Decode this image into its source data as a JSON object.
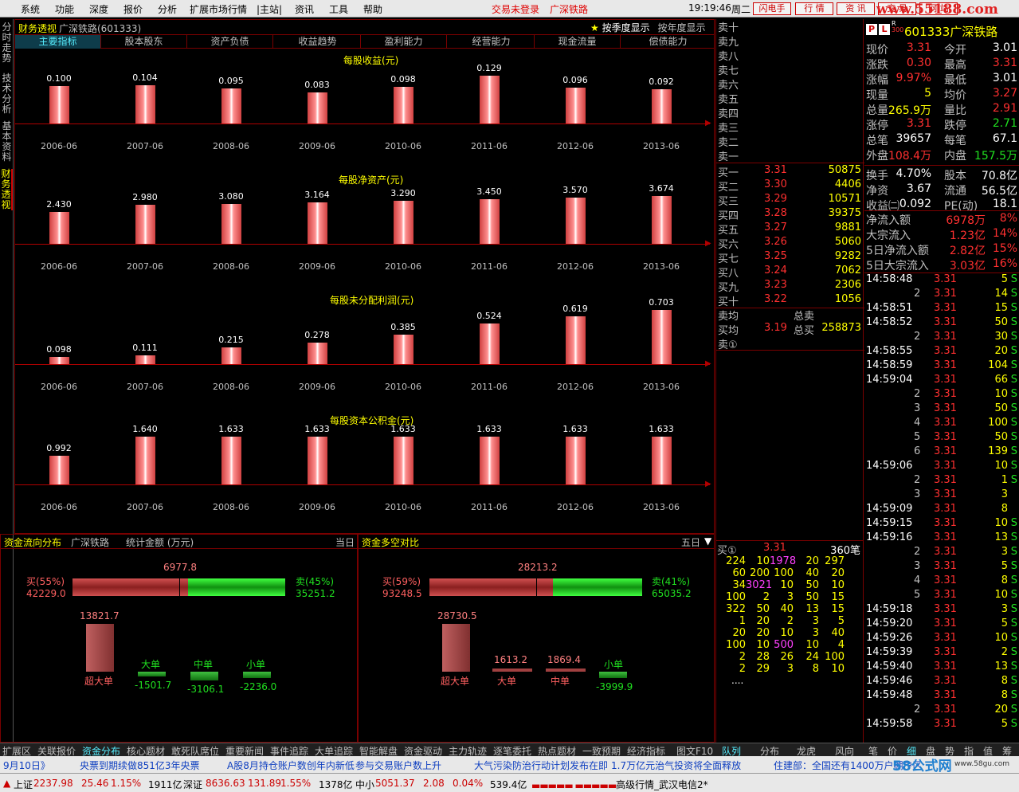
{
  "menu": {
    "items": [
      "系统",
      "功能",
      "深度",
      "报价",
      "分析",
      "扩展市场行情",
      "|主站|",
      "资讯",
      "工具",
      "帮助"
    ],
    "login_status": "交易未登录",
    "current_stock": "广深铁路",
    "time": "19:19:46",
    "weekday": "周二",
    "buttons": [
      "闪电手",
      "行 情",
      "资 讯",
      "交 易",
      "网 站"
    ],
    "watermark": "www.55188.com"
  },
  "side_tabs": [
    "分时走势",
    "技术分析",
    "基本资料",
    "财务透视"
  ],
  "fin": {
    "title": "财务透视",
    "stock": "广深铁路(601333)",
    "season_btn": "按季度显示",
    "year_btn": "按年度显示",
    "tabs": [
      "主要指标",
      "股本股东",
      "资产负债",
      "收益趋势",
      "盈利能力",
      "经营能力",
      "现金流量",
      "偿债能力"
    ],
    "years": [
      "2006-06",
      "2007-06",
      "2008-06",
      "2009-06",
      "2010-06",
      "2011-06",
      "2012-06",
      "2013-06"
    ]
  },
  "chart_data": [
    {
      "type": "bar",
      "title": "每股收益(元)",
      "categories": [
        "2006-06",
        "2007-06",
        "2008-06",
        "2009-06",
        "2010-06",
        "2011-06",
        "2012-06",
        "2013-06"
      ],
      "values": [
        0.1,
        0.104,
        0.095,
        0.083,
        0.098,
        0.129,
        0.096,
        0.092
      ],
      "labels": [
        "0.100",
        "0.104",
        "0.095",
        "0.083",
        "0.098",
        "0.129",
        "0.096",
        "0.092"
      ]
    },
    {
      "type": "bar",
      "title": "每股净资产(元)",
      "categories": [
        "2006-06",
        "2007-06",
        "2008-06",
        "2009-06",
        "2010-06",
        "2011-06",
        "2012-06",
        "2013-06"
      ],
      "values": [
        2.43,
        2.98,
        3.08,
        3.164,
        3.29,
        3.45,
        3.57,
        3.674
      ],
      "labels": [
        "2.430",
        "2.980",
        "3.080",
        "3.164",
        "3.290",
        "3.450",
        "3.570",
        "3.674"
      ]
    },
    {
      "type": "bar",
      "title": "每股未分配利润(元)",
      "categories": [
        "2006-06",
        "2007-06",
        "2008-06",
        "2009-06",
        "2010-06",
        "2011-06",
        "2012-06",
        "2013-06"
      ],
      "values": [
        0.098,
        0.111,
        0.215,
        0.278,
        0.385,
        0.524,
        0.619,
        0.703
      ],
      "labels": [
        "0.098",
        "0.111",
        "0.215",
        "0.278",
        "0.385",
        "0.524",
        "0.619",
        "0.703"
      ]
    },
    {
      "type": "bar",
      "title": "每股资本公积金(元)",
      "categories": [
        "2006-06",
        "2007-06",
        "2008-06",
        "2009-06",
        "2010-06",
        "2011-06",
        "2012-06",
        "2013-06"
      ],
      "values": [
        0.992,
        1.64,
        1.633,
        1.633,
        1.633,
        1.633,
        1.633,
        1.633
      ],
      "labels": [
        "0.992",
        "1.640",
        "1.633",
        "1.633",
        "1.633",
        "1.633",
        "1.633",
        "1.633"
      ]
    }
  ],
  "sell_levels": [
    "卖十",
    "卖九",
    "卖八",
    "卖七",
    "卖六",
    "卖五",
    "卖四",
    "卖三",
    "卖二",
    "卖一"
  ],
  "buy_levels": [
    {
      "l": "买一",
      "p": "3.31",
      "v": "50875"
    },
    {
      "l": "买二",
      "p": "3.30",
      "v": "4406"
    },
    {
      "l": "买三",
      "p": "3.29",
      "v": "10571"
    },
    {
      "l": "买四",
      "p": "3.28",
      "v": "39375"
    },
    {
      "l": "买五",
      "p": "3.27",
      "v": "9881"
    },
    {
      "l": "买六",
      "p": "3.26",
      "v": "5060"
    },
    {
      "l": "买七",
      "p": "3.25",
      "v": "9282"
    },
    {
      "l": "买八",
      "p": "3.24",
      "v": "7062"
    },
    {
      "l": "买九",
      "p": "3.23",
      "v": "2306"
    },
    {
      "l": "买十",
      "p": "3.22",
      "v": "1056"
    }
  ],
  "avg": {
    "sell_label": "卖均",
    "sell_total_label": "总卖",
    "buy_label": "买均",
    "buy_price": "3.19",
    "buy_total_label": "总买",
    "buy_total": "258873",
    "sell1": "卖①"
  },
  "stock": {
    "code": "601333",
    "name": "广深铁路",
    "box_p": "P",
    "box_l": "L",
    "box_r": "R",
    "box_300": "300"
  },
  "info": [
    {
      "l1": "现价",
      "v1": "3.31",
      "c1": "red",
      "l2": "今开",
      "v2": "3.01",
      "c2": "wht"
    },
    {
      "l1": "涨跌",
      "v1": "0.30",
      "c1": "red",
      "l2": "最高",
      "v2": "3.31",
      "c2": "red"
    },
    {
      "l1": "涨幅",
      "v1": "9.97%",
      "c1": "red",
      "l2": "最低",
      "v2": "3.01",
      "c2": "wht"
    },
    {
      "l1": "现量",
      "v1": "5",
      "c1": "yel",
      "l2": "均价",
      "v2": "3.27",
      "c2": "red"
    },
    {
      "l1": "总量",
      "v1": "265.9万",
      "c1": "yel",
      "l2": "量比",
      "v2": "2.91",
      "c2": "red"
    },
    {
      "l1": "涨停",
      "v1": "3.31",
      "c1": "red",
      "l2": "跌停",
      "v2": "2.71",
      "c2": "grn"
    },
    {
      "l1": "总笔",
      "v1": "39657",
      "c1": "wht",
      "l2": "每笔",
      "v2": "67.1",
      "c2": "wht"
    },
    {
      "l1": "外盘",
      "v1": "108.4万",
      "c1": "red",
      "l2": "内盘",
      "v2": "157.5万",
      "c2": "grn"
    },
    {
      "l1": "换手",
      "v1": "4.70%",
      "c1": "wht",
      "l2": "股本",
      "v2": "70.8亿",
      "c2": "wht"
    },
    {
      "l1": "净资",
      "v1": "3.67",
      "c1": "wht",
      "l2": "流通",
      "v2": "56.5亿",
      "c2": "wht"
    },
    {
      "l1": "收益㈡",
      "v1": "0.092",
      "c1": "wht",
      "l2": "PE(动)",
      "v2": "18.1",
      "c2": "wht"
    }
  ],
  "flows": [
    {
      "l": "净流入额",
      "v": "6978万",
      "p": "8%"
    },
    {
      "l": "大宗流入",
      "v": "1.23亿",
      "p": "14%"
    },
    {
      "l": "5日净流入额",
      "v": "2.82亿",
      "p": "15%"
    },
    {
      "l": "5日大宗流入",
      "v": "3.03亿",
      "p": "16%"
    }
  ],
  "ticks": [
    {
      "t": "14:58:48",
      "p": "3.31",
      "v": "5",
      "s": "S"
    },
    {
      "t": "2",
      "p": "3.31",
      "v": "14",
      "s": "S"
    },
    {
      "t": "14:58:51",
      "p": "3.31",
      "v": "15",
      "s": "S"
    },
    {
      "t": "14:58:52",
      "p": "3.31",
      "v": "50",
      "s": "S"
    },
    {
      "t": "2",
      "p": "3.31",
      "v": "30",
      "s": "S"
    },
    {
      "t": "14:58:55",
      "p": "3.31",
      "v": "20",
      "s": "S"
    },
    {
      "t": "14:58:59",
      "p": "3.31",
      "v": "104",
      "s": "S"
    },
    {
      "t": "14:59:04",
      "p": "3.31",
      "v": "66",
      "s": "S"
    },
    {
      "t": "2",
      "p": "3.31",
      "v": "10",
      "s": "S"
    },
    {
      "t": "3",
      "p": "3.31",
      "v": "50",
      "s": "S"
    },
    {
      "t": "4",
      "p": "3.31",
      "v": "100",
      "s": "S"
    },
    {
      "t": "5",
      "p": "3.31",
      "v": "50",
      "s": "S"
    },
    {
      "t": "6",
      "p": "3.31",
      "v": "139",
      "s": "S"
    },
    {
      "t": "14:59:06",
      "p": "3.31",
      "v": "10",
      "s": "S"
    },
    {
      "t": "2",
      "p": "3.31",
      "v": "1",
      "s": "S"
    },
    {
      "t": "3",
      "p": "3.31",
      "v": "3",
      "s": ""
    },
    {
      "t": "14:59:09",
      "p": "3.31",
      "v": "8",
      "s": ""
    },
    {
      "t": "14:59:15",
      "p": "3.31",
      "v": "10",
      "s": "S"
    },
    {
      "t": "14:59:16",
      "p": "3.31",
      "v": "13",
      "s": "S"
    },
    {
      "t": "2",
      "p": "3.31",
      "v": "3",
      "s": "S"
    },
    {
      "t": "3",
      "p": "3.31",
      "v": "5",
      "s": "S"
    },
    {
      "t": "4",
      "p": "3.31",
      "v": "8",
      "s": "S"
    },
    {
      "t": "5",
      "p": "3.31",
      "v": "10",
      "s": "S"
    },
    {
      "t": "14:59:18",
      "p": "3.31",
      "v": "3",
      "s": "S"
    },
    {
      "t": "14:59:20",
      "p": "3.31",
      "v": "5",
      "s": "S"
    },
    {
      "t": "14:59:26",
      "p": "3.31",
      "v": "10",
      "s": "S"
    },
    {
      "t": "14:59:39",
      "p": "3.31",
      "v": "2",
      "s": "S"
    },
    {
      "t": "14:59:40",
      "p": "3.31",
      "v": "13",
      "s": "S"
    },
    {
      "t": "14:59:46",
      "p": "3.31",
      "v": "8",
      "s": "S"
    },
    {
      "t": "14:59:48",
      "p": "3.31",
      "v": "8",
      "s": "S"
    },
    {
      "t": "2",
      "p": "3.31",
      "v": "20",
      "s": "S"
    },
    {
      "t": "14:59:58",
      "p": "3.31",
      "v": "5",
      "s": "S"
    }
  ],
  "fund_flow": {
    "title": "资金流向分布",
    "stock": "广深铁路",
    "unit": "统计金额 (万元)",
    "period": "当日",
    "net": "6977.8",
    "buy_pct": "买(55%)",
    "buy_amt": "42229.0",
    "sell_pct": "卖(45%)",
    "sell_amt": "35251.2",
    "cats": [
      {
        "name": "超大单",
        "val": "13821.7"
      },
      {
        "name": "大单",
        "val": "-1501.7"
      },
      {
        "name": "中单",
        "val": "-3106.1"
      },
      {
        "name": "小单",
        "val": "-2236.0"
      }
    ]
  },
  "fund_vs": {
    "title": "资金多空对比",
    "period": "五日",
    "net": "28213.2",
    "buy_pct": "买(59%)",
    "buy_amt": "93248.5",
    "sell_pct": "卖(41%)",
    "sell_amt": "65035.2",
    "cats": [
      {
        "name": "超大单",
        "val": "28730.5"
      },
      {
        "name": "大单",
        "val": "1613.2"
      },
      {
        "name": "中单",
        "val": "1869.4"
      },
      {
        "name": "小单",
        "val": "-3999.9"
      }
    ]
  },
  "queue": {
    "label": "买①",
    "price": "3.31",
    "count": "360笔",
    "more": "....",
    "rows": [
      [
        "224",
        "10",
        "1978",
        "20",
        "297"
      ],
      [
        "60",
        "200",
        "100",
        "40",
        "20"
      ],
      [
        "34",
        "3021",
        "10",
        "50",
        "10"
      ],
      [
        "100",
        "2",
        "3",
        "50",
        "15"
      ],
      [
        "322",
        "50",
        "40",
        "13",
        "15"
      ],
      [
        "1",
        "20",
        "2",
        "3",
        "5"
      ],
      [
        "20",
        "20",
        "10",
        "3",
        "40"
      ],
      [
        "100",
        "10",
        "500",
        "10",
        "4"
      ],
      [
        "2",
        "28",
        "26",
        "24",
        "100"
      ],
      [
        "2",
        "29",
        "3",
        "8",
        "10"
      ]
    ]
  },
  "bottom_tabs": [
    "扩展区",
    "关联报价",
    "资金分布",
    "核心题材",
    "敢死队席位",
    "重要新闻",
    "事件追踪",
    "大单追踪",
    "智能解盘",
    "资金驱动",
    "主力轨迹",
    "逐笔委托",
    "热点题材",
    "一致预期",
    "经济指标",
    "图文F10"
  ],
  "bottom_tabs_right": [
    "队列",
    "分布",
    "龙虎",
    "风向",
    "笔",
    "价",
    "细",
    "盘",
    "势",
    "指",
    "值",
    "筹"
  ],
  "news": [
    "9月10日》",
    "央票到期续做851亿3年央票",
    "A股8月持仓账户数创年内新低",
    "参与交易账户数上升",
    "大气污染防治行动计划发布在即",
    "1.7万亿元治气投资将全面释放",
    "住建部：全国还有1400万户棚户区",
    "58公式网",
    "www.58gu.com"
  ],
  "status": {
    "sh_label": "上证",
    "sh_index": "2237.98",
    "sh_chg": "25.46",
    "sh_pct": "1.15%",
    "sh_amt": "1911亿",
    "sz_label": "深证",
    "sz_index": "8636.63",
    "sz_chg": "131.89",
    "sz_pct": "1.55%",
    "sz_amt": "1378亿",
    "zx_label": "中小",
    "zx_index": "5051.37",
    "zx_chg": "2.08",
    "zx_pct": "0.04%",
    "zx_amt": "539.4亿",
    "feed": "高级行情_武汉电信2*"
  }
}
